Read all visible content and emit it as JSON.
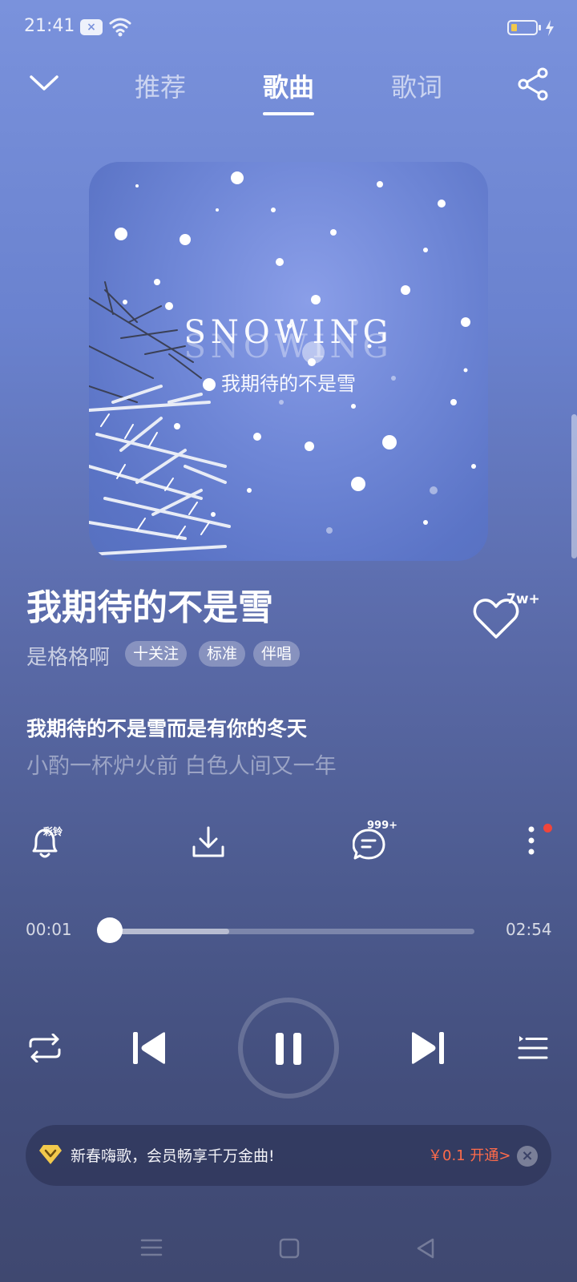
{
  "status_bar": {
    "time": "21:41",
    "message_badge": "×",
    "battery_level_percent": 15
  },
  "nav": {
    "tabs": [
      {
        "label": "推荐"
      },
      {
        "label": "歌曲"
      },
      {
        "label": "歌词"
      }
    ],
    "active_tab": 1,
    "collapse_icon": "chevron-down-icon",
    "share_icon": "share-icon"
  },
  "album": {
    "art_title": "SNOWING",
    "art_subtitle": "我期待的不是雪"
  },
  "song": {
    "title": "我期待的不是雪",
    "artist": "是格格啊",
    "follow_label": "十关注",
    "quality_label": "标准",
    "accompany_label": "伴唱",
    "like_count": "7w+"
  },
  "lyrics": {
    "current": "我期待的不是雪而是有你的冬天",
    "next": "小酌一杯炉火前 白色人间又一年"
  },
  "actions": {
    "ringtone_label": "彩铃",
    "comment_count": "999+",
    "icons": [
      "bell-icon",
      "download-icon",
      "comment-icon",
      "more-icon"
    ]
  },
  "progress": {
    "elapsed": "00:01",
    "total": "02:54",
    "played_fraction": 0.006,
    "buffered_fraction": 0.33
  },
  "controls": {
    "icons": [
      "repeat-icon",
      "previous-icon",
      "pause-icon",
      "next-icon",
      "playlist-icon"
    ],
    "state": "playing"
  },
  "promo": {
    "text": "新春嗨歌，会员畅享千万金曲!",
    "price_text": "￥0.1 开通>",
    "close_icon": "close-icon",
    "accent_color": "#ff6b4a"
  },
  "colors": {
    "background_top": "#7a92dc",
    "background_bottom": "#3f4870",
    "vip_badge": "#f2c94c"
  }
}
